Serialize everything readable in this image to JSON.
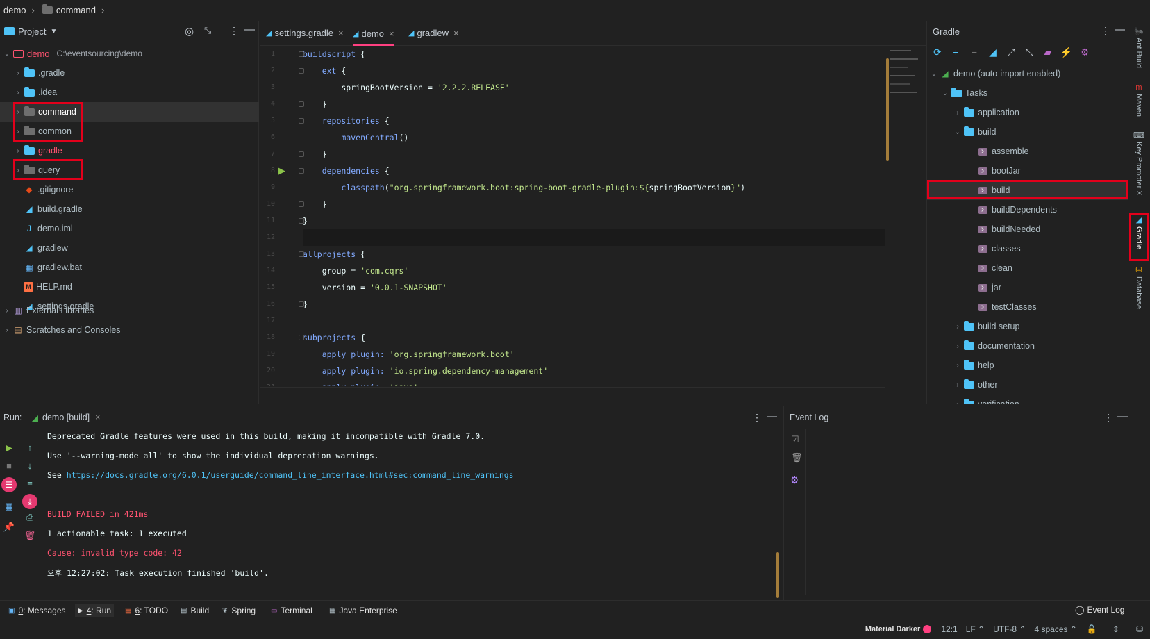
{
  "breadcrumb": {
    "project": "demo",
    "folder": "command"
  },
  "project_panel": {
    "title": "Project",
    "root": {
      "name": "demo",
      "path": "C:\\eventsourcing\\demo"
    },
    "items": [
      {
        "label": ".gradle",
        "type": "folder",
        "color": "#4fc3f7",
        "label_color": "#b0bec5"
      },
      {
        "label": ".idea",
        "type": "folder",
        "color": "#4fc3f7",
        "label_color": "#b0bec5"
      },
      {
        "label": "command",
        "type": "folder",
        "color": "#6e6e6e",
        "label_color": "#ffffff"
      },
      {
        "label": "common",
        "type": "folder",
        "color": "#6e6e6e",
        "label_color": "#b0bec5"
      },
      {
        "label": "gradle",
        "type": "folder",
        "color": "#4fc3f7",
        "label_color": "#ff5370"
      },
      {
        "label": "query",
        "type": "folder",
        "color": "#6e6e6e",
        "label_color": "#b0bec5"
      },
      {
        "label": ".gitignore",
        "type": "file",
        "icon": "git-icon",
        "label_color": "#b0bec5"
      },
      {
        "label": "build.gradle",
        "type": "file",
        "icon": "gradle-icon",
        "label_color": "#b0bec5"
      },
      {
        "label": "demo.iml",
        "type": "file",
        "icon": "iml-icon",
        "label_color": "#b0bec5"
      },
      {
        "label": "gradlew",
        "type": "file",
        "icon": "gradle-icon",
        "label_color": "#b0bec5"
      },
      {
        "label": "gradlew.bat",
        "type": "file",
        "icon": "windows-icon",
        "label_color": "#b0bec5"
      },
      {
        "label": "HELP.md",
        "type": "file",
        "icon": "markdown-icon",
        "label_color": "#b0bec5"
      },
      {
        "label": "settings.gradle",
        "type": "file",
        "icon": "gradle-icon",
        "label_color": "#b0bec5"
      }
    ],
    "external_libraries": "External Libraries",
    "scratches": "Scratches and Consoles"
  },
  "editor": {
    "tabs": [
      {
        "label": "settings.gradle"
      },
      {
        "label": "demo",
        "active": true
      },
      {
        "label": "gradlew"
      }
    ],
    "lines": [
      {
        "n": "1",
        "parts": [
          [
            "kw",
            "buildscript"
          ],
          [
            "id",
            " {"
          ]
        ]
      },
      {
        "n": "2",
        "parts": [
          [
            "id",
            "    "
          ],
          [
            "kw",
            "ext"
          ],
          [
            "id",
            " {"
          ]
        ]
      },
      {
        "n": "3",
        "parts": [
          [
            "id",
            "        springBootVersion = "
          ],
          [
            "str",
            "'2.2.2.RELEASE'"
          ]
        ]
      },
      {
        "n": "4",
        "parts": [
          [
            "id",
            "    }"
          ]
        ]
      },
      {
        "n": "5",
        "parts": [
          [
            "id",
            "    "
          ],
          [
            "kw",
            "repositories"
          ],
          [
            "id",
            " {"
          ]
        ]
      },
      {
        "n": "6",
        "parts": [
          [
            "id",
            "        "
          ],
          [
            "kw",
            "mavenCentral"
          ],
          [
            "id",
            "()"
          ]
        ]
      },
      {
        "n": "7",
        "parts": [
          [
            "id",
            "    }"
          ]
        ]
      },
      {
        "n": "8",
        "parts": [
          [
            "id",
            "    "
          ],
          [
            "kw",
            "dependencies"
          ],
          [
            "id",
            " {"
          ]
        ]
      },
      {
        "n": "9",
        "parts": [
          [
            "id",
            "        "
          ],
          [
            "kw",
            "classpath"
          ],
          [
            "id",
            "("
          ],
          [
            "str",
            "\"org.springframework.boot:spring-boot-gradle-plugin:${"
          ],
          [
            "id",
            "springBootVersion"
          ],
          [
            "str",
            "}\""
          ],
          [
            "id",
            ")"
          ]
        ]
      },
      {
        "n": "10",
        "parts": [
          [
            "id",
            "    }"
          ]
        ]
      },
      {
        "n": "11",
        "parts": [
          [
            "id",
            "}"
          ]
        ]
      },
      {
        "n": "12",
        "parts": []
      },
      {
        "n": "13",
        "parts": [
          [
            "kw",
            "allprojects"
          ],
          [
            "id",
            " {"
          ]
        ]
      },
      {
        "n": "14",
        "parts": [
          [
            "id",
            "    group = "
          ],
          [
            "str",
            "'com.cqrs'"
          ]
        ]
      },
      {
        "n": "15",
        "parts": [
          [
            "id",
            "    version = "
          ],
          [
            "str",
            "'0.0.1-SNAPSHOT'"
          ]
        ]
      },
      {
        "n": "16",
        "parts": [
          [
            "id",
            "}"
          ]
        ]
      },
      {
        "n": "17",
        "parts": []
      },
      {
        "n": "18",
        "parts": [
          [
            "kw",
            "subprojects"
          ],
          [
            "id",
            " {"
          ]
        ]
      },
      {
        "n": "19",
        "parts": [
          [
            "id",
            "    "
          ],
          [
            "kw",
            "apply plugin:"
          ],
          [
            "id",
            " "
          ],
          [
            "str",
            "'org.springframework.boot'"
          ]
        ]
      },
      {
        "n": "20",
        "parts": [
          [
            "id",
            "    "
          ],
          [
            "kw",
            "apply plugin:"
          ],
          [
            "id",
            " "
          ],
          [
            "str",
            "'io.spring.dependency-management'"
          ]
        ]
      },
      {
        "n": "21",
        "parts": [
          [
            "id",
            "    "
          ],
          [
            "kw",
            "apply plugin:"
          ],
          [
            "id",
            " "
          ],
          [
            "str",
            "'java'"
          ]
        ]
      }
    ]
  },
  "gradle_panel": {
    "title": "Gradle",
    "root": "demo (auto-import enabled)",
    "tasks_label": "Tasks",
    "groups_before": [
      "application"
    ],
    "build_group": "build",
    "build_tasks": [
      "assemble",
      "bootJar",
      "build",
      "buildDependents",
      "buildNeeded",
      "classes",
      "clean",
      "jar",
      "testClasses"
    ],
    "groups_after": [
      "build setup",
      "documentation",
      "help",
      "other",
      "verification"
    ]
  },
  "right_strip": [
    "Ant Build",
    "Maven",
    "Key Promoter X",
    "Gradle",
    "Database"
  ],
  "run_panel": {
    "label": "Run:",
    "tab": "demo [build]",
    "lines": [
      {
        "text": "Deprecated Gradle features were used in this build, making it incompatible with Gradle 7.0.",
        "kind": "normal"
      },
      {
        "text": "Use '--warning-mode all' to show the individual deprecation warnings.",
        "kind": "normal"
      },
      {
        "prefix": "See ",
        "link": "https://docs.gradle.org/6.0.1/userguide/command_line_interface.html#sec:command_line_warnings",
        "kind": "link"
      },
      {
        "text": "",
        "kind": "normal"
      },
      {
        "text": "BUILD FAILED in 421ms",
        "kind": "error"
      },
      {
        "text": "1 actionable task: 1 executed",
        "kind": "normal"
      },
      {
        "text": "Cause: invalid type code: 42",
        "kind": "error"
      },
      {
        "text": "오후 12:27:02: Task execution finished 'build'.",
        "kind": "normal"
      }
    ]
  },
  "event_log": {
    "title": "Event Log"
  },
  "bottom_tools": [
    {
      "num": "0",
      "rest": ": Messages"
    },
    {
      "num": "4",
      "rest": ": Run",
      "active": true
    },
    {
      "num": "6",
      "rest": ": TODO"
    },
    {
      "num": "",
      "rest": "Build"
    },
    {
      "num": "",
      "rest": "Spring"
    },
    {
      "num": "",
      "rest": "Terminal"
    },
    {
      "num": "",
      "rest": "Java Enterprise"
    }
  ],
  "event_log_button": "Event Log",
  "status": {
    "theme": "Material Darker",
    "position": "12:1",
    "line_sep": "LF ⌃",
    "encoding": "UTF-8 ⌃",
    "indent": "4 spaces ⌃"
  },
  "colors": {
    "accent": "#ff4081",
    "highlight_box": "#e3001b",
    "gradle_cyan": "#4fc3f7"
  }
}
